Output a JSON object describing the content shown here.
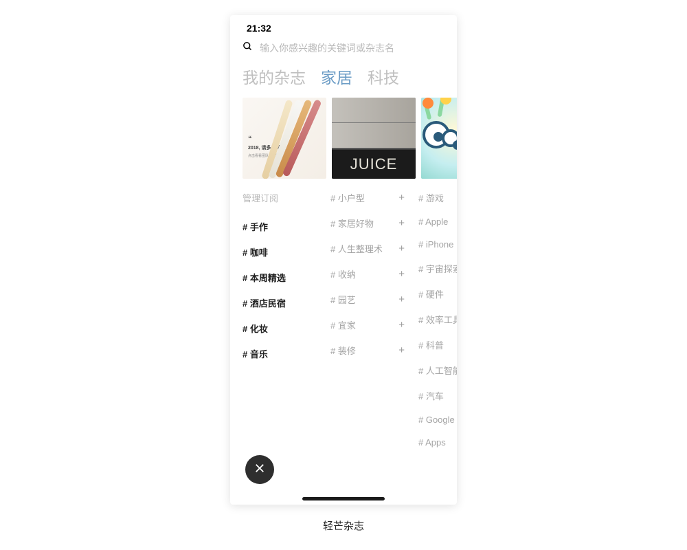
{
  "status": {
    "time": "21:32"
  },
  "search": {
    "placeholder": "输入你感兴趣的关键词或杂志名"
  },
  "tabs": [
    {
      "label": "我的杂志",
      "active": false
    },
    {
      "label": "家居",
      "active": true
    },
    {
      "label": "科技",
      "active": false
    }
  ],
  "cards": {
    "card1": {
      "year_line": "2018, 请多多关照",
      "sub_line": "点击看看团队推荐精选文章"
    },
    "card2": {
      "mat_text": "JUICE"
    }
  },
  "columns": [
    {
      "header": "管理订阅",
      "items": [
        {
          "label": "# 手作"
        },
        {
          "label": "# 咖啡"
        },
        {
          "label": "# 本周精选"
        },
        {
          "label": "# 酒店民宿"
        },
        {
          "label": "# 化妆"
        },
        {
          "label": "# 音乐"
        }
      ]
    },
    {
      "header": "",
      "items": [
        {
          "label": "# 小户型",
          "add": true
        },
        {
          "label": "# 家居好物",
          "add": true
        },
        {
          "label": "# 人生整理术",
          "add": true
        },
        {
          "label": "# 收纳",
          "add": true
        },
        {
          "label": "# 园艺",
          "add": true
        },
        {
          "label": "# 宜家",
          "add": true
        },
        {
          "label": "# 装修",
          "add": true
        }
      ]
    },
    {
      "header": "",
      "items": [
        {
          "label": "# 游戏"
        },
        {
          "label": "# Apple"
        },
        {
          "label": "# iPhone"
        },
        {
          "label": "# 宇宙探索"
        },
        {
          "label": "# 硬件"
        },
        {
          "label": "# 效率工具"
        },
        {
          "label": "# 科普"
        },
        {
          "label": "# 人工智能"
        },
        {
          "label": "# 汽车"
        },
        {
          "label": "# Google"
        },
        {
          "label": "# Apps"
        }
      ]
    }
  ],
  "app_name": "轻芒杂志"
}
